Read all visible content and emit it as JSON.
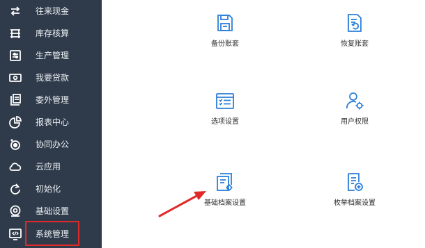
{
  "sidebar": {
    "items": [
      {
        "label": "往来现金",
        "icon": "exchange-arrows-icon"
      },
      {
        "label": "库存核算",
        "icon": "warehouse-icon"
      },
      {
        "label": "生产管理",
        "icon": "sliders-icon"
      },
      {
        "label": "我要贷款",
        "icon": "money-icon"
      },
      {
        "label": "委外管理",
        "icon": "outsource-doc-icon"
      },
      {
        "label": "报表中心",
        "icon": "pie-chart-icon"
      },
      {
        "label": "协同办公",
        "icon": "collaboration-icon"
      },
      {
        "label": "云应用",
        "icon": "cloud-icon"
      },
      {
        "label": "初始化",
        "icon": "refresh-icon"
      },
      {
        "label": "基础设置",
        "icon": "settings-icon"
      },
      {
        "label": "系统管理",
        "icon": "code-monitor-icon"
      }
    ],
    "highlighted_item": "系统管理"
  },
  "tiles": [
    {
      "label": "备份账套",
      "icon": "backup-save-icon"
    },
    {
      "label": "恢复账套",
      "icon": "restore-doc-icon"
    },
    {
      "label": "选项设置",
      "icon": "options-list-icon"
    },
    {
      "label": "用户权限",
      "icon": "user-gear-icon"
    },
    {
      "label": "基础档案设置",
      "icon": "archive-gear-icon"
    },
    {
      "label": "枚举档案设置",
      "icon": "archive-plus-icon"
    }
  ],
  "colors": {
    "sidebar_bg": "#2f3a4a",
    "accent_blue": "#2b7fd8",
    "highlight_red": "#e02a2a"
  }
}
